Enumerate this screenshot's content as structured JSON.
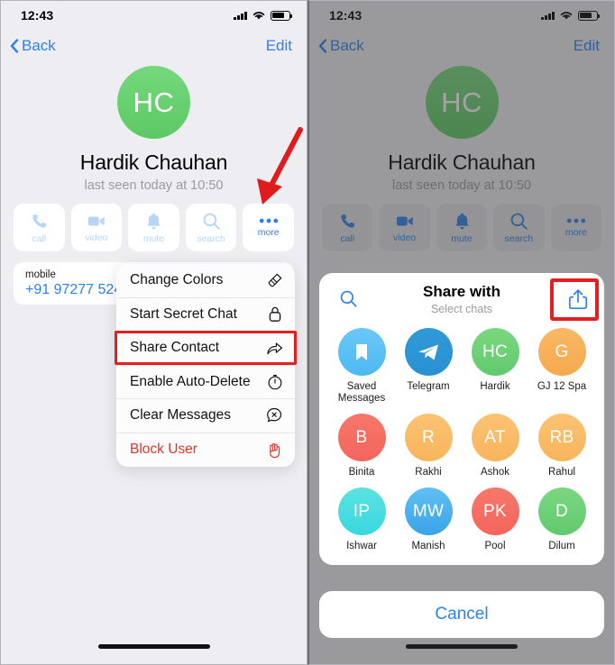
{
  "left_screen": {
    "status_bar": {
      "time": "12:43",
      "signal_icon": "cellular-bars-icon",
      "wifi_icon": "wifi-icon",
      "battery_icon": "battery-icon"
    },
    "nav": {
      "back_label": "Back",
      "edit_label": "Edit",
      "back_icon": "chevron-left-icon"
    },
    "profile": {
      "avatar_initials": "HC",
      "name": "Hardik Chauhan",
      "status": "last seen today at 10:50",
      "avatar_color": "#5cc863"
    },
    "actions": [
      {
        "label": "call",
        "icon": "phone-icon",
        "active": false
      },
      {
        "label": "video",
        "icon": "video-camera-icon",
        "active": false
      },
      {
        "label": "mute",
        "icon": "bell-icon",
        "active": false
      },
      {
        "label": "search",
        "icon": "search-icon",
        "active": false
      },
      {
        "label": "more",
        "icon": "ellipsis-icon",
        "active": true
      }
    ],
    "info_card": {
      "label": "mobile",
      "value": "+91 97277 524"
    },
    "context_menu": [
      {
        "label": "Change Colors",
        "icon": "paintbrush-icon",
        "danger": false
      },
      {
        "label": "Start Secret Chat",
        "icon": "lock-icon",
        "danger": false
      },
      {
        "label": "Share Contact",
        "icon": "share-arrow-icon",
        "danger": false
      },
      {
        "label": "Enable Auto-Delete",
        "icon": "timer-icon",
        "danger": false
      },
      {
        "label": "Clear Messages",
        "icon": "chat-x-icon",
        "danger": false
      },
      {
        "label": "Block User",
        "icon": "hand-stop-icon",
        "danger": true
      }
    ],
    "annotations": {
      "arrow_color": "#e01b1b",
      "highlight_color": "#e41f1f",
      "highlighted_menu_item": "Share Contact"
    }
  },
  "right_screen": {
    "status_bar": {
      "time": "12:43",
      "signal_icon": "cellular-bars-icon",
      "wifi_icon": "wifi-icon",
      "battery_icon": "battery-icon"
    },
    "nav": {
      "back_label": "Back",
      "edit_label": "Edit",
      "back_icon": "chevron-left-icon"
    },
    "profile": {
      "avatar_initials": "HC",
      "name": "Hardik Chauhan",
      "status": "last seen today at 10:50"
    },
    "actions": [
      {
        "label": "call",
        "icon": "phone-icon"
      },
      {
        "label": "video",
        "icon": "video-camera-icon"
      },
      {
        "label": "mute",
        "icon": "bell-icon"
      },
      {
        "label": "search",
        "icon": "search-icon"
      },
      {
        "label": "more",
        "icon": "ellipsis-icon"
      }
    ],
    "share_sheet": {
      "title": "Share with",
      "subtitle": "Select chats",
      "search_icon": "search-icon",
      "share_icon": "share-upload-icon",
      "chats": [
        {
          "name": "Saved Messages",
          "initials": "",
          "icon": "bookmark-icon",
          "color": "#4db8f0",
          "color2": "#69c9f7"
        },
        {
          "name": "Telegram",
          "initials": "",
          "icon": "telegram-plane-icon",
          "color": "#2a91d1",
          "color2": "#2f9ad8"
        },
        {
          "name": "Hardik",
          "initials": "HC",
          "icon": "",
          "color": "#62c96f",
          "color2": "#7ad87f"
        },
        {
          "name": "GJ 12 Spa",
          "initials": "G",
          "icon": "",
          "color": "#f5a94e",
          "color2": "#f8b963"
        },
        {
          "name": "Binita",
          "initials": "B",
          "icon": "",
          "color": "#f4655c",
          "color2": "#f8776a"
        },
        {
          "name": "Rakhi",
          "initials": "R",
          "icon": "",
          "color": "#f8b45c",
          "color2": "#fbc373"
        },
        {
          "name": "Ashok",
          "initials": "AT",
          "icon": "",
          "color": "#f8b45c",
          "color2": "#fbc373"
        },
        {
          "name": "Rahul",
          "initials": "RB",
          "icon": "",
          "color": "#f8b45c",
          "color2": "#fbc373"
        },
        {
          "name": "Ishwar",
          "initials": "IP",
          "icon": "",
          "color": "#3ad7e0",
          "color2": "#5ae3e0"
        },
        {
          "name": "Manish",
          "initials": "MW",
          "icon": "",
          "color": "#3aa3e8",
          "color2": "#5fc0f2"
        },
        {
          "name": "Pool",
          "initials": "PK",
          "icon": "",
          "color": "#f4655c",
          "color2": "#f8776a"
        },
        {
          "name": "Dilum",
          "initials": "D",
          "icon": "",
          "color": "#62c96f",
          "color2": "#7ad87f"
        }
      ]
    },
    "cancel_label": "Cancel",
    "annotations": {
      "highlight_color": "#e41f1f",
      "highlighted_control": "share-upload-icon"
    }
  }
}
